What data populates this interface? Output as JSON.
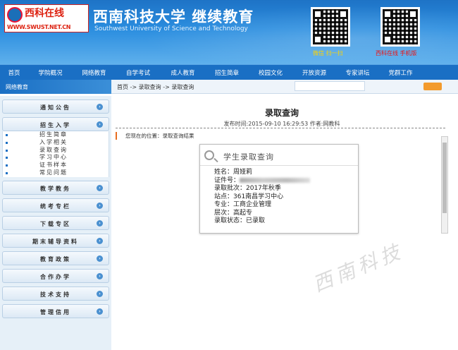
{
  "header": {
    "logo_text": "西科在线",
    "logo_url": "WWW.SWUST.NET.CN",
    "school_cn": "西南科技大学 继续教育",
    "school_en": "Southwest University of Science and Technology",
    "qr_left_caption": "微信 扫一扫",
    "qr_right_caption": "西科在线 手机版"
  },
  "nav": [
    "首页",
    "学院概况",
    "网络教育",
    "自学考试",
    "成人教育",
    "招生简章",
    "校园文化",
    "开放资源",
    "专家讲坛",
    "党群工作"
  ],
  "topbar": {
    "section_title": "网络教育",
    "breadcrumb": "首页 -> 录取查询 -> 录取查询"
  },
  "sidebar": {
    "menus": [
      {
        "label": "通知公告"
      },
      {
        "label": "招生入学",
        "items": [
          "招生简章",
          "入学相关",
          "录取查询",
          "学习中心",
          "证书样本",
          "常见问题"
        ]
      },
      {
        "label": "教学教务"
      },
      {
        "label": "统考专栏"
      },
      {
        "label": "下载专区"
      },
      {
        "label": "期末辅导资料"
      },
      {
        "label": "教育政策"
      },
      {
        "label": "合作办学"
      },
      {
        "label": "技术支持"
      },
      {
        "label": "管理信用"
      }
    ]
  },
  "main": {
    "title": "录取查询",
    "pubinfo": "发布时间:2015-09-10 16:29:53 作者:网教科",
    "location": "您现在的位置：录取查询结果"
  },
  "card": {
    "title": "学生录取查询",
    "name": "姓名：周娅莉",
    "id_label": "证件号：",
    "batch": "录取批次：2017年秋季",
    "site": "站点：361南昌学习中心",
    "major": "专业：工商企业管理",
    "level": "层次：高起专",
    "status": "录取状态：已录取"
  },
  "watermark": "西南科技"
}
